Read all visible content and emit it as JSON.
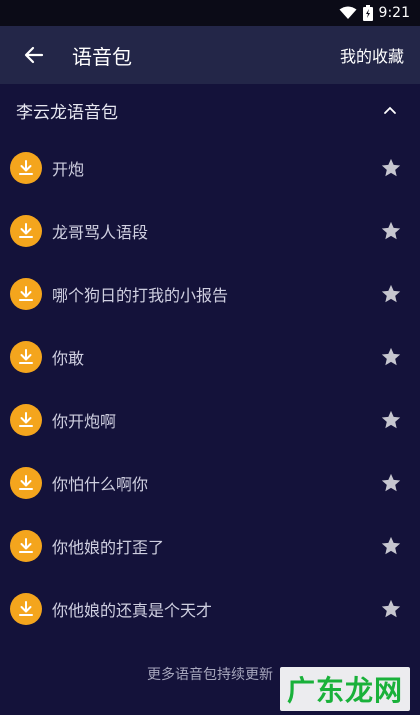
{
  "status": {
    "time": "9:21"
  },
  "appbar": {
    "title": "语音包",
    "favorites": "我的收藏"
  },
  "group": {
    "title": "李云龙语音包"
  },
  "items": [
    {
      "label": "开炮"
    },
    {
      "label": "龙哥骂人语段"
    },
    {
      "label": "哪个狗日的打我的小报告"
    },
    {
      "label": "你敢"
    },
    {
      "label": "你开炮啊"
    },
    {
      "label": "你怕什么啊你"
    },
    {
      "label": "你他娘的打歪了"
    },
    {
      "label": "你他娘的还真是个天才"
    }
  ],
  "footer": {
    "note": "更多语音包持续更新"
  },
  "watermark": {
    "text": "广东龙网"
  },
  "colors": {
    "accent": "#f4a51d",
    "background": "#14123a",
    "appbar": "#232648"
  }
}
